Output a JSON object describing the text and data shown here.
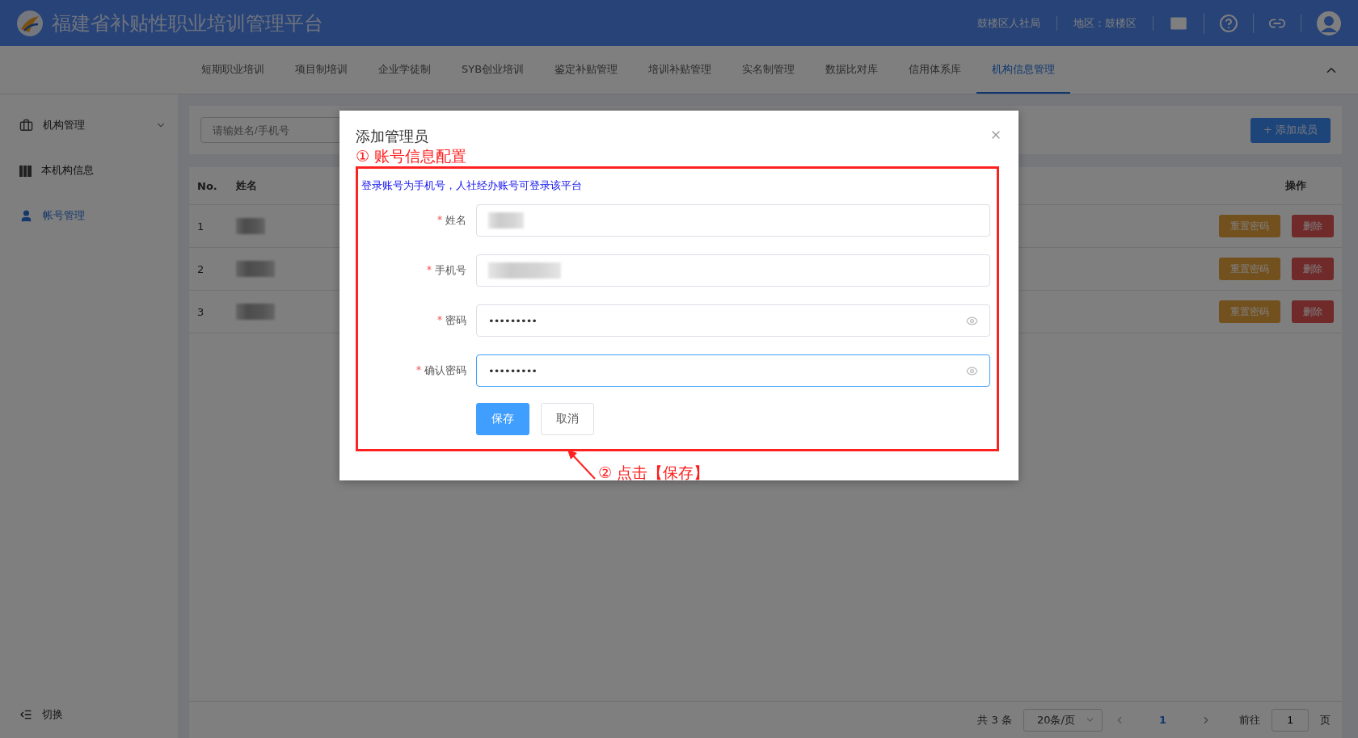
{
  "header": {
    "title": "福建省补贴性职业培训管理平台",
    "org": "鼓楼区人社局",
    "region": "地区：鼓楼区"
  },
  "nav": {
    "tabs": [
      {
        "label": "短期职业培训",
        "selected": false
      },
      {
        "label": "项目制培训",
        "selected": false
      },
      {
        "label": "企业学徒制",
        "selected": false
      },
      {
        "label": "SYB创业培训",
        "selected": false
      },
      {
        "label": "鉴定补贴管理",
        "selected": false
      },
      {
        "label": "培训补贴管理",
        "selected": false
      },
      {
        "label": "实名制管理",
        "selected": false
      },
      {
        "label": "数据比对库",
        "selected": false
      },
      {
        "label": "信用体系库",
        "selected": false
      },
      {
        "label": "机构信息管理",
        "selected": true
      }
    ]
  },
  "sidebar": {
    "items": [
      {
        "label": "机构管理",
        "kind": "group",
        "selected": false
      },
      {
        "label": "本机构信息",
        "kind": "building",
        "selected": false
      },
      {
        "label": "帐号管理",
        "kind": "user",
        "selected": true
      }
    ],
    "footer": "切换"
  },
  "toolbar": {
    "search_placeholder": "请输姓名/手机号",
    "add_button": "+ 添加成员"
  },
  "table": {
    "columns": [
      "No.",
      "姓名",
      "操作"
    ],
    "rows": [
      {
        "no": "1",
        "actions": [
          "重置密码",
          "删除"
        ]
      },
      {
        "no": "2",
        "actions": [
          "重置密码",
          "删除"
        ]
      },
      {
        "no": "3",
        "actions": [
          "重置密码",
          "删除"
        ]
      }
    ]
  },
  "pagination": {
    "total": "共 3 条",
    "page_size": "20条/页",
    "current": "1",
    "goto_label": "前往",
    "goto_value": "1",
    "goto_suffix": "页"
  },
  "dialog": {
    "title": "添加管理员",
    "note": "登录账号为手机号，人社经办账号可登录该平台",
    "fields": [
      {
        "label": "姓名",
        "required": true,
        "kind": "redacted",
        "focused": false
      },
      {
        "label": "手机号",
        "required": true,
        "kind": "redacted",
        "focused": false
      },
      {
        "label": "密码",
        "required": true,
        "kind": "password",
        "value": "•••••••••",
        "focused": false
      },
      {
        "label": "确认密码",
        "required": true,
        "kind": "password",
        "value": "•••••••••",
        "focused": true
      }
    ],
    "buttons": [
      {
        "label": "保存",
        "kind": "primary"
      },
      {
        "label": "取消",
        "kind": "default"
      }
    ]
  },
  "annotations": [
    {
      "text": "① 账号信息配置"
    },
    {
      "text": "② 点击【保存】"
    }
  ]
}
